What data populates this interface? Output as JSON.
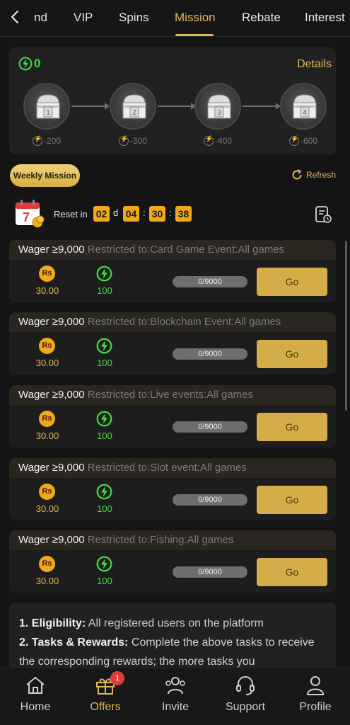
{
  "tabs": [
    {
      "label": "nd"
    },
    {
      "label": "VIP"
    },
    {
      "label": "Spins"
    },
    {
      "label": "Mission"
    },
    {
      "label": "Rebate"
    },
    {
      "label": "Interest"
    }
  ],
  "summary": {
    "energy_total": "0",
    "details_label": "Details"
  },
  "chests": [
    {
      "number": "1",
      "cost": "-200"
    },
    {
      "number": "2",
      "cost": "-300"
    },
    {
      "number": "3",
      "cost": "-400"
    },
    {
      "number": "4",
      "cost": "-600"
    }
  ],
  "mission_bar": {
    "weekly_label": "Weekly Mission",
    "refresh_label": "Refresh"
  },
  "reset": {
    "label": "Reset in",
    "calendar_day": "7",
    "days": "02",
    "days_unit": "d",
    "hours": "04",
    "minutes": "30",
    "seconds": "38",
    "sep": ":"
  },
  "missions": [
    {
      "title": "Wager ≥9,000",
      "restriction": "Restricted to:Card Game Event:All games",
      "coin_symbol": "Rs",
      "coin_reward": "30.00",
      "energy_reward": "100",
      "progress_text": "0/9000",
      "go_label": "Go"
    },
    {
      "title": "Wager ≥9,000",
      "restriction": "Restricted to:Blockchain Event:All games",
      "coin_symbol": "Rs",
      "coin_reward": "30.00",
      "energy_reward": "100",
      "progress_text": "0/9000",
      "go_label": "Go"
    },
    {
      "title": "Wager ≥9,000",
      "restriction": "Restricted to:Live events:All games",
      "coin_symbol": "Rs",
      "coin_reward": "30.00",
      "energy_reward": "100",
      "progress_text": "0/9000",
      "go_label": "Go"
    },
    {
      "title": "Wager ≥9,000",
      "restriction": "Restricted to:Slot event:All games",
      "coin_symbol": "Rs",
      "coin_reward": "30.00",
      "energy_reward": "100",
      "progress_text": "0/9000",
      "go_label": "Go"
    },
    {
      "title": "Wager ≥9,000",
      "restriction": "Restricted to:Fishing:All games",
      "coin_symbol": "Rs",
      "coin_reward": "30.00",
      "energy_reward": "100",
      "progress_text": "0/9000",
      "go_label": "Go"
    }
  ],
  "rules": {
    "item1_heading": "1. Eligibility:",
    "item1_text": " All registered users on the platform",
    "item2_heading": "2. Tasks & Rewards:",
    "item2_text": " Complete the above tasks to receive the corresponding rewards; the more tasks you"
  },
  "nav": [
    {
      "label": "Home",
      "icon": "home-icon"
    },
    {
      "label": "Offers",
      "icon": "gift-icon",
      "badge": "1"
    },
    {
      "label": "Invite",
      "icon": "invite-icon"
    },
    {
      "label": "Support",
      "icon": "headset-icon"
    },
    {
      "label": "Profile",
      "icon": "profile-icon"
    }
  ],
  "colors": {
    "accent": "#e0b85a",
    "energy": "#3fdc3f",
    "background": "#141414",
    "timer": "#f0a81a"
  }
}
